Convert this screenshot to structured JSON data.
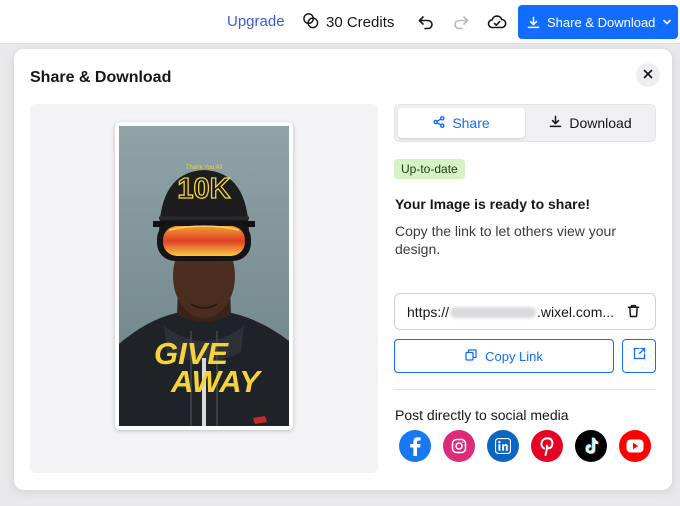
{
  "topbar": {
    "upgrade_label": "Upgrade",
    "credits_label": "30 Credits",
    "share_download_label": "Share & Download",
    "icons": [
      "credits-icon",
      "undo-icon",
      "redo-icon",
      "cloud-save-icon",
      "download-icon",
      "chevron-down-icon"
    ]
  },
  "modal": {
    "title": "Share & Download",
    "close_icon": "close-icon"
  },
  "preview": {
    "design_small_text": "Thank You All",
    "design_big_text": "10K",
    "design_word_1": "GIVE",
    "design_word_2": "AWAY",
    "accent_color": "#f5d33a"
  },
  "tabs": [
    {
      "label": "Share",
      "icon": "share-icon",
      "selected": true
    },
    {
      "label": "Download",
      "icon": "download-icon",
      "selected": false
    }
  ],
  "status_badge": "Up-to-date",
  "ready_title": "Your Image is ready to share!",
  "ready_desc": "Copy the link to let others view your design.",
  "link": {
    "prefix": "https://",
    "suffix": ".wixel.com...",
    "trash_icon": "trash-icon"
  },
  "copy_link_label": "Copy Link",
  "open_link_icon": "external-link-icon",
  "social": {
    "label": "Post directly to social media",
    "networks": [
      {
        "name": "Facebook",
        "icon": "facebook-icon",
        "color": "#1877f2"
      },
      {
        "name": "Instagram",
        "icon": "instagram-icon",
        "color": "#dd2a7b"
      },
      {
        "name": "LinkedIn",
        "icon": "linkedin-icon",
        "color": "#0a66c2"
      },
      {
        "name": "Pinterest",
        "icon": "pinterest-icon",
        "color": "#e60023"
      },
      {
        "name": "TikTok",
        "icon": "tiktok-icon",
        "color": "#000000"
      },
      {
        "name": "YouTube",
        "icon": "youtube-icon",
        "color": "#ff0000"
      }
    ]
  },
  "colors": {
    "brand": "#116dff",
    "badge_bg": "#d4f2c4"
  }
}
